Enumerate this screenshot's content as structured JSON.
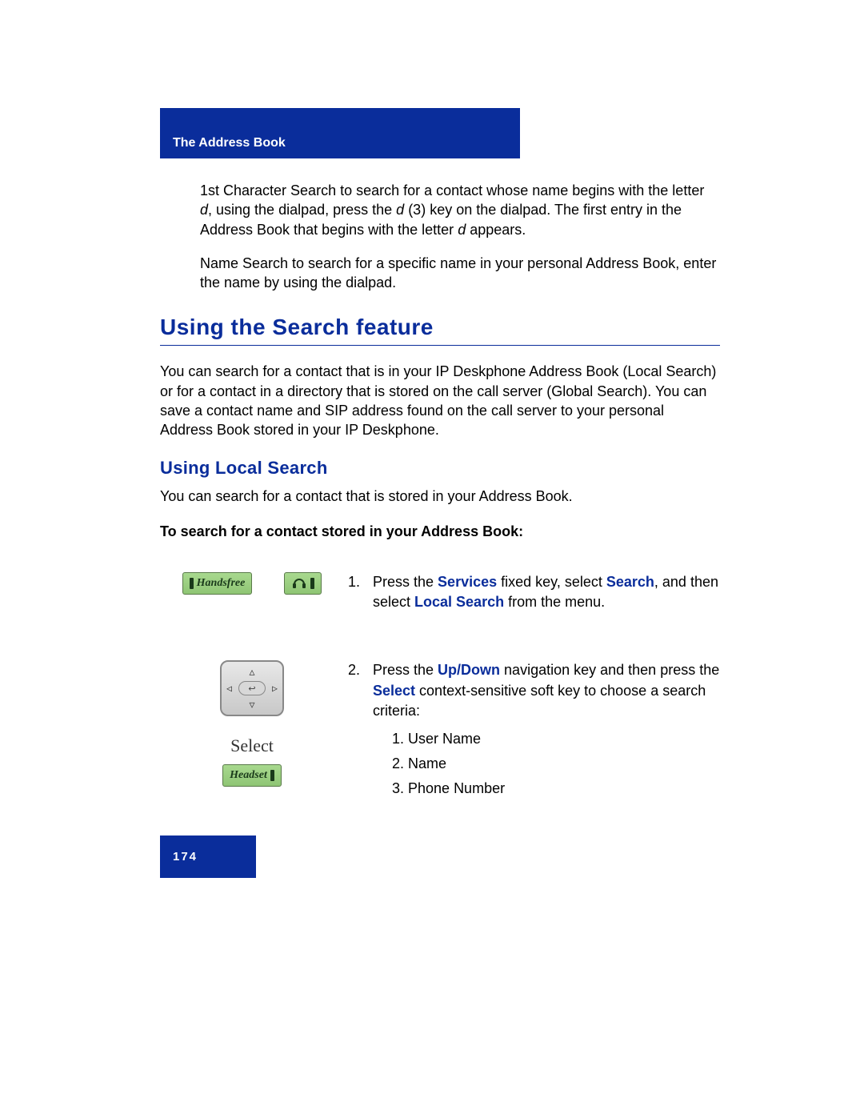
{
  "header": {
    "title": "The Address Book"
  },
  "intro": {
    "p1_a": "1st Character Search to search for a contact whose name begins with the letter ",
    "p1_d1": "d",
    "p1_b": ", using the dialpad, press the ",
    "p1_d2": "d",
    "p1_c": " (3) key on the dialpad. The first entry in the Address Book that begins with the letter ",
    "p1_d3": "d",
    "p1_d": " appears.",
    "p2": "Name Search to search for a specific name in your personal Address Book, enter the name by using the dialpad."
  },
  "h1": "Using the Search feature",
  "para1": "You can search for a contact that is in your IP Deskphone Address Book (Local Search) or for a contact in a directory that is stored on the call server (Global Search). You can save a contact name and SIP address found on the call server to your personal Address Book stored in your IP Deskphone.",
  "h2": "Using Local Search",
  "para2": "You can search for a contact that is stored in your Address Book.",
  "instr": "To search for a contact stored in your Address Book:",
  "keys": {
    "handsfree": "Handsfree",
    "headset": "Headset",
    "select_label": "Select"
  },
  "steps": {
    "s1": {
      "num": "1.",
      "a": "Press the ",
      "services": "Services",
      "b": " fixed key, select ",
      "search": "Search",
      "c": ", and then select ",
      "local_search": "Local Search",
      "d": " from the menu."
    },
    "s2": {
      "num": "2.",
      "a": "Press the ",
      "updown": "Up/Down",
      "b": " navigation key and then press the ",
      "select": "Select",
      "c": " context-sensitive soft key to choose a search criteria:",
      "opt1": "1. User Name",
      "opt2": "2. Name",
      "opt3": "3. Phone Number"
    }
  },
  "footer": {
    "page": "174"
  }
}
